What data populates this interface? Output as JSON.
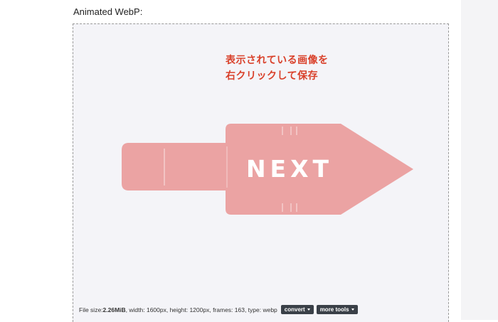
{
  "section": {
    "title": "Animated WebP:"
  },
  "preview": {
    "note_line1": "表示されている画像を",
    "note_line2": "右クリックして保存",
    "image_text": "NEXT",
    "arrow_color": "#eba3a3",
    "note_color": "#d9412b"
  },
  "info": {
    "size_label": "File size: ",
    "size_value": "2.26MiB",
    "details": ", width: 1600px, height: 1200px, frames: 163, type: webp",
    "convert_label": "convert",
    "more_tools_label": "more tools"
  }
}
